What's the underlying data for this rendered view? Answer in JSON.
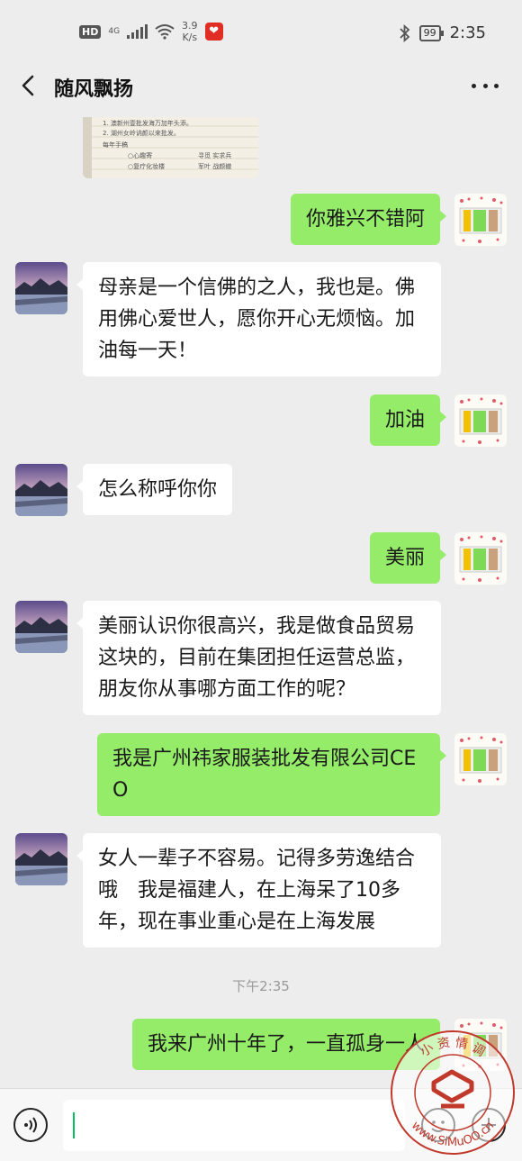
{
  "status_bar": {
    "hd": "HD",
    "network": "4G",
    "speed_value": "3.9",
    "speed_unit": "K/s",
    "battery": "99",
    "time": "2:35",
    "icons": [
      "signal-icon",
      "wifi-icon",
      "app-icon",
      "bluetooth-icon",
      "battery-icon"
    ]
  },
  "header": {
    "title": "随风飘扬",
    "back_icon": "chevron-left-icon",
    "more_icon": "more-dots-icon"
  },
  "photo_note": {
    "lines": [
      "1. 澳新州壹批发海万加年头添。",
      "2. 湖州女岭讷颜以来批发。",
      "每年手稿",
      "○心趣寄",
      "○复疗化妆楼",
      "寻觅 实求兵",
      "军叶 战颜撤"
    ]
  },
  "messages": [
    {
      "side": "out",
      "text": "你雅兴不错阿"
    },
    {
      "side": "in",
      "text": "母亲是一个信佛的之人，我也是。佛用佛心爱世人，愿你开心无烦恼。加油每一天！"
    },
    {
      "side": "out",
      "text": "加油"
    },
    {
      "side": "in",
      "text": "怎么称呼你你"
    },
    {
      "side": "out",
      "text": "美丽"
    },
    {
      "side": "in",
      "text": "美丽认识你很高兴，我是做食品贸易这块的，目前在集团担任运营总监，朋友你从事哪方面工作的呢？"
    },
    {
      "side": "out",
      "text": "我是广州祎家服装批发有限公司CEO"
    },
    {
      "side": "in",
      "text": "女人一辈子不容易。记得多劳逸结合哦　我是福建人，在上海呆了10多年，现在事业重心是在上海发展"
    },
    {
      "side": "out",
      "text": "我来广州十年了，一直孤身一人"
    }
  ],
  "timestamp": "下午2:35",
  "input_bar": {
    "voice_icon": "voice-icon",
    "emoji_icon": "emoji-icon",
    "plus_icon": "plus-icon",
    "value": ""
  },
  "watermark": {
    "text": "www.SiMuOO.cn",
    "top_text": "小 资 情 调"
  },
  "colors": {
    "background": "#ededed",
    "incoming_bubble": "#ffffff",
    "outgoing_bubble": "#95ec69",
    "caret": "#07c160",
    "watermark": "#c0392b"
  }
}
